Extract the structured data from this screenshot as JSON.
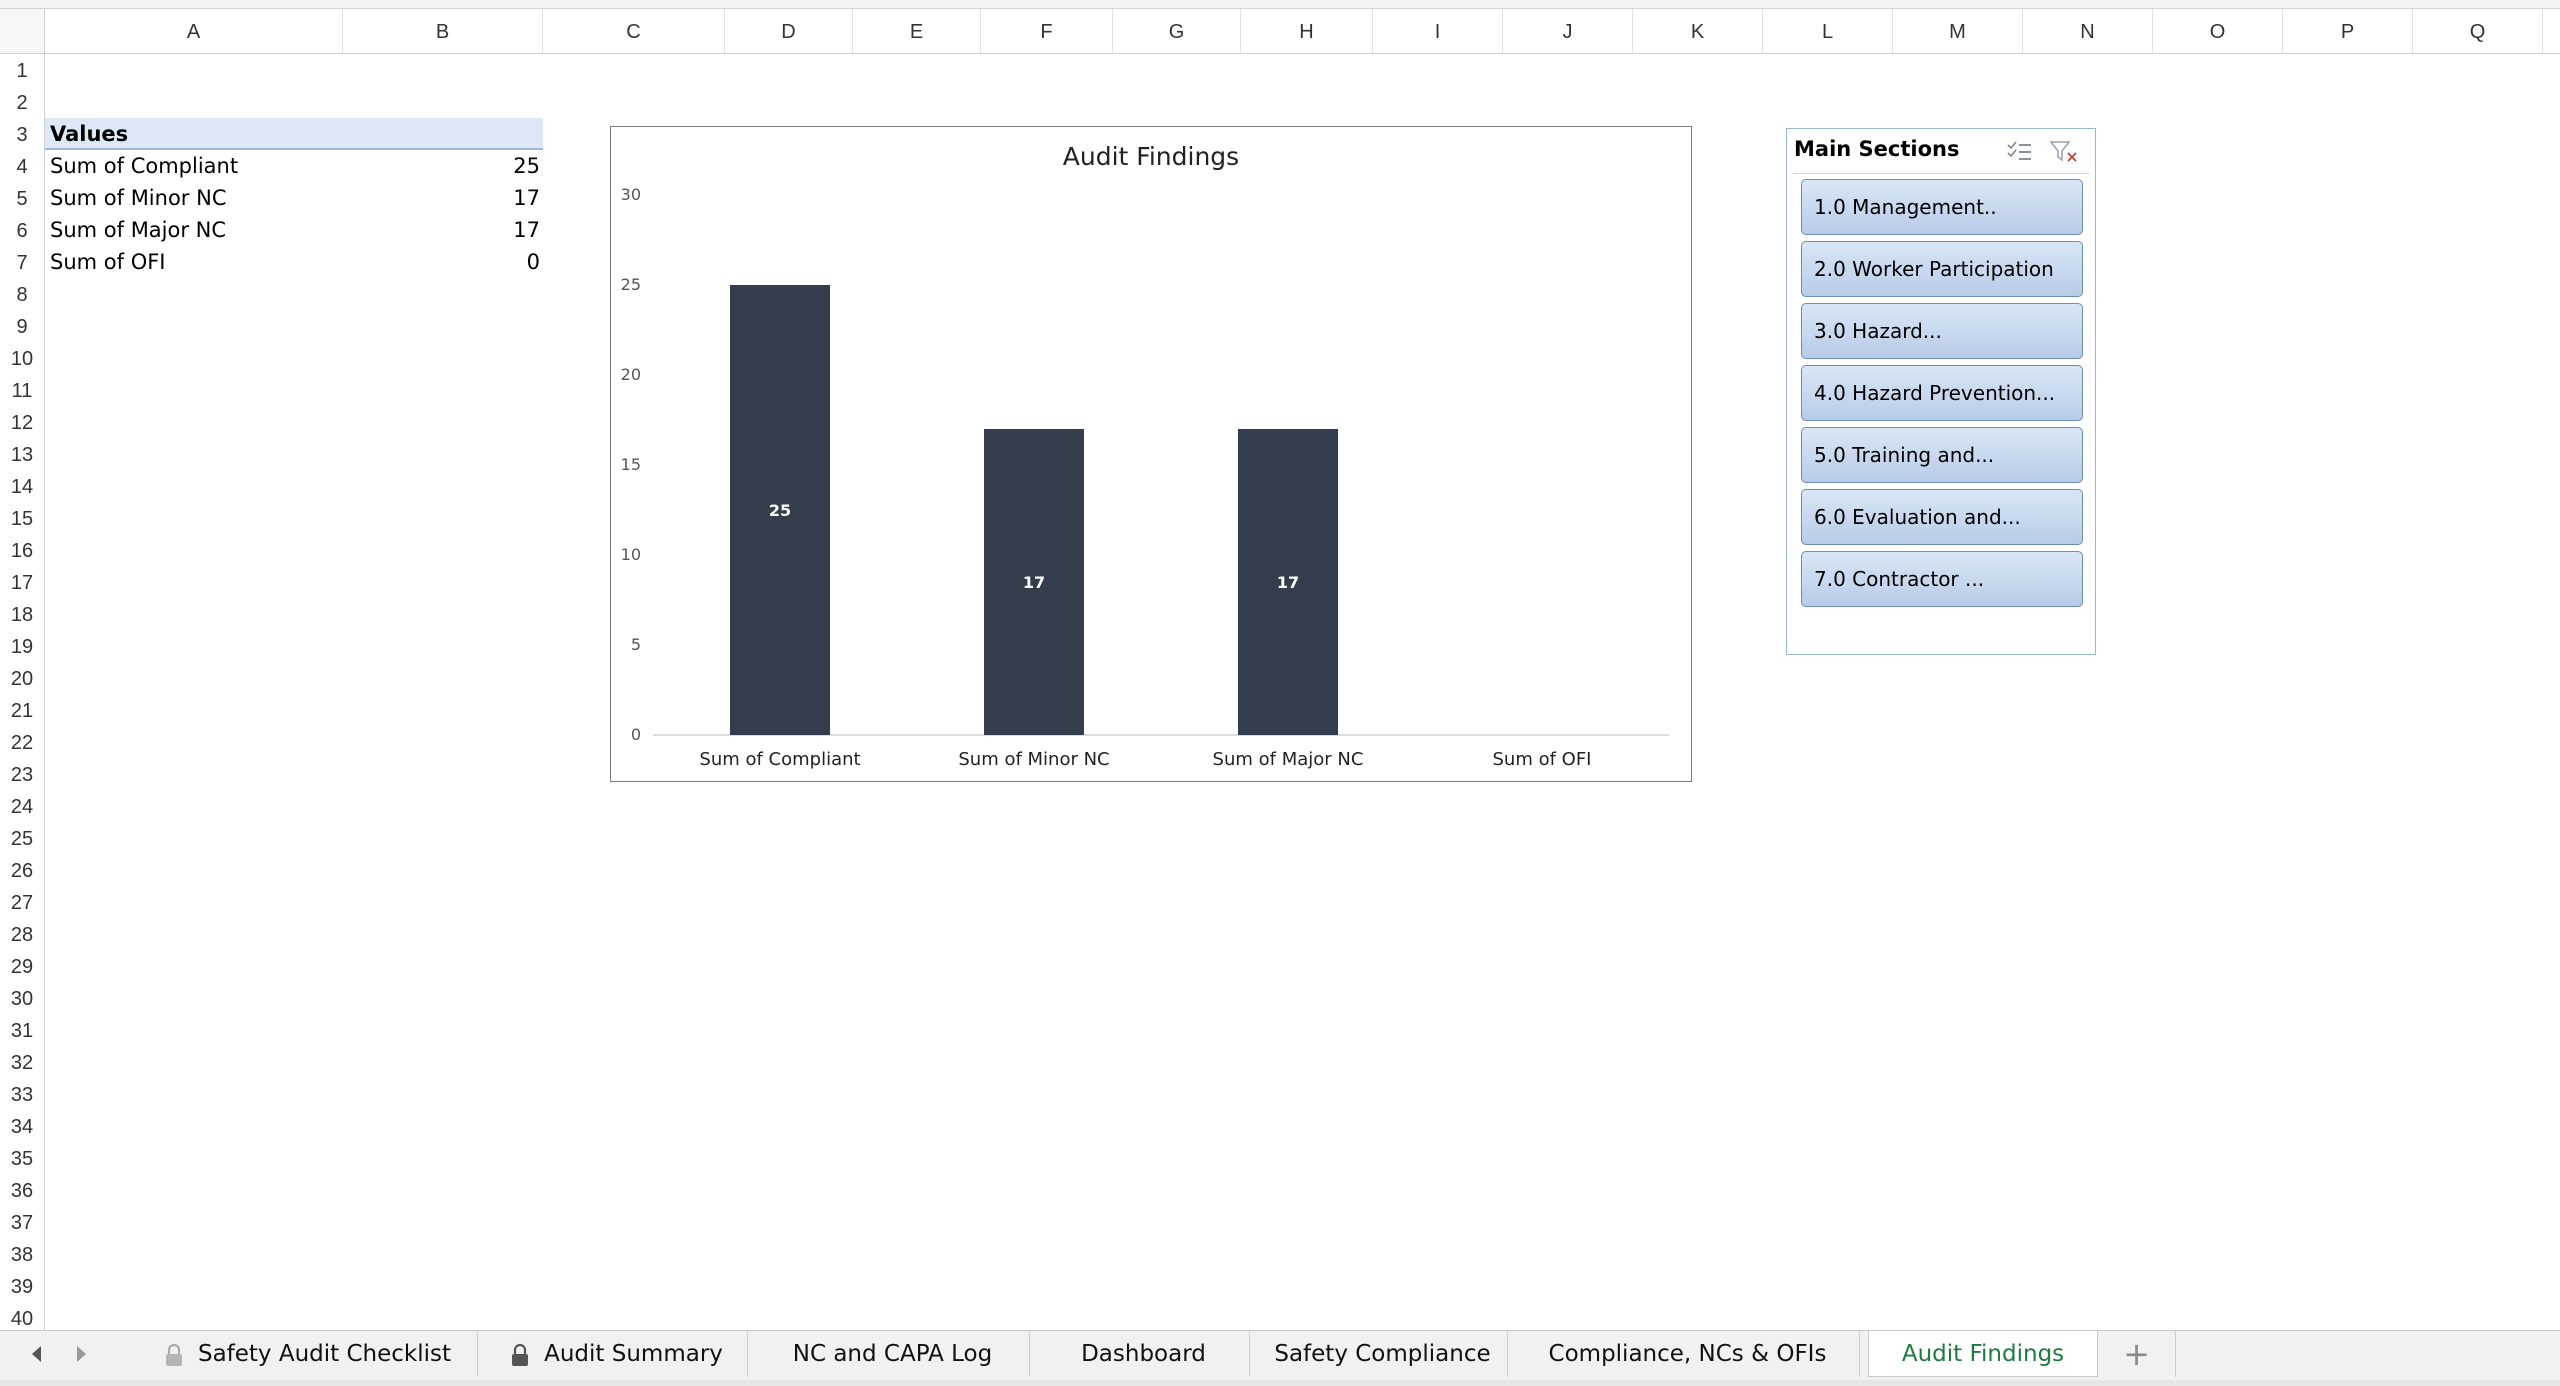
{
  "columns": [
    "A",
    "B",
    "C",
    "D",
    "E",
    "F",
    "G",
    "H",
    "I",
    "J",
    "K",
    "L",
    "M",
    "N",
    "O",
    "P",
    "Q"
  ],
  "rows": [
    "1",
    "2",
    "3",
    "4",
    "5",
    "6",
    "7",
    "8",
    "9",
    "10",
    "11",
    "12",
    "13",
    "14",
    "15",
    "16",
    "17",
    "18",
    "19",
    "20",
    "21",
    "22",
    "23",
    "24",
    "25",
    "26",
    "27",
    "28",
    "29",
    "30",
    "31",
    "32",
    "33",
    "34",
    "35",
    "36",
    "37",
    "38",
    "39",
    "40"
  ],
  "pivot": {
    "header": "Values",
    "rows": [
      {
        "label": "Sum of Compliant",
        "value": "25"
      },
      {
        "label": "Sum of Minor NC",
        "value": "17"
      },
      {
        "label": "Sum of Major NC",
        "value": "17"
      },
      {
        "label": "Sum of OFI",
        "value": "0"
      }
    ]
  },
  "chart_data": {
    "type": "bar",
    "title": "Audit Findings",
    "categories": [
      "Sum of Compliant",
      "Sum of Minor NC",
      "Sum of Major NC",
      "Sum of OFI"
    ],
    "values": [
      25,
      17,
      17,
      0
    ],
    "data_labels": [
      "25",
      "17",
      "17",
      ""
    ],
    "ylim": [
      0,
      30
    ],
    "yticks": [
      "0",
      "5",
      "10",
      "15",
      "20",
      "25",
      "30"
    ],
    "xlabel": "",
    "ylabel": "",
    "grid": false,
    "legend": "none",
    "bar_color": "#343d4b"
  },
  "slicer": {
    "title": "Main Sections",
    "items": [
      "1.0 Management..",
      "2.0 Worker Participation",
      "3.0 Hazard...",
      "4.0 Hazard Prevention...",
      "5.0 Training and...",
      "6.0 Evaluation and...",
      "7.0 Contractor ..."
    ]
  },
  "tabs": [
    {
      "label": "Safety Audit Checklist",
      "locked": true
    },
    {
      "label": "Audit Summary",
      "locked": true
    },
    {
      "label": "NC and CAPA Log",
      "locked": false
    },
    {
      "label": "Dashboard",
      "locked": false
    },
    {
      "label": "Safety Compliance",
      "locked": false
    },
    {
      "label": "Compliance, NCs & OFIs",
      "locked": false
    },
    {
      "label": "Audit Findings",
      "locked": false,
      "active": true
    }
  ],
  "add_sheet_label": "+",
  "colors": {
    "active_tab": "#1e7b3f",
    "bar": "#343d4b",
    "slicer_item": "#c6d7ee"
  }
}
